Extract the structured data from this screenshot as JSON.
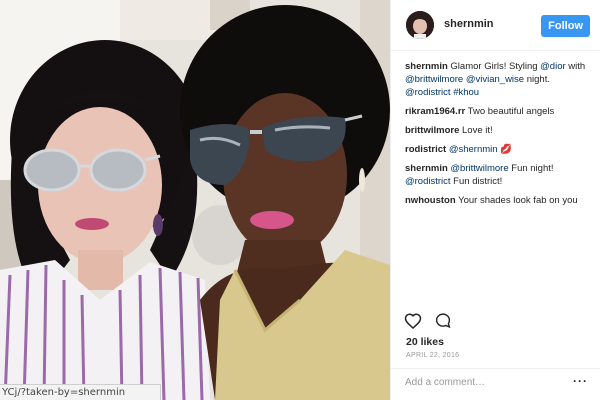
{
  "photo": {
    "description_icon": "photo-image",
    "status_url": "YCj/?taken-by=shernmin"
  },
  "post": {
    "username": "shernmin",
    "follow_label": "Follow",
    "follow_color": "#3897f0",
    "comments": [
      {
        "user": "shernmin",
        "text": "Glamor Girls! Styling ",
        "mention1": "@dior",
        "text2": " with ",
        "mention2": "@brittwilmore",
        "text3": " ",
        "mention3": "@vivian_wise",
        "text4": " night. ",
        "mention4": "@rodistrict",
        "text5": " ",
        "mention5": "#khou"
      },
      {
        "user": "rikram1964.rr",
        "text": " Two beautiful angels"
      },
      {
        "user": "brittwilmore",
        "text": " Love it!"
      },
      {
        "user": "rodistrict",
        "text": " ",
        "mention1": "@shernmin",
        "text2": " 💋"
      },
      {
        "user": "shernmin",
        "text": " ",
        "mention1": "@brittwilmore",
        "text2": " Fun night! ",
        "mention2": "@rodistrict",
        "text3": " Fun district!"
      },
      {
        "user": "nwhouston",
        "text": " Your shades look fab on you"
      }
    ],
    "likes": "20 likes",
    "date": "APRIL 22, 2016",
    "add_comment_placeholder": "Add a comment…",
    "more_label": "···",
    "icons": {
      "like": "heart-icon",
      "comment": "comment-icon"
    }
  }
}
